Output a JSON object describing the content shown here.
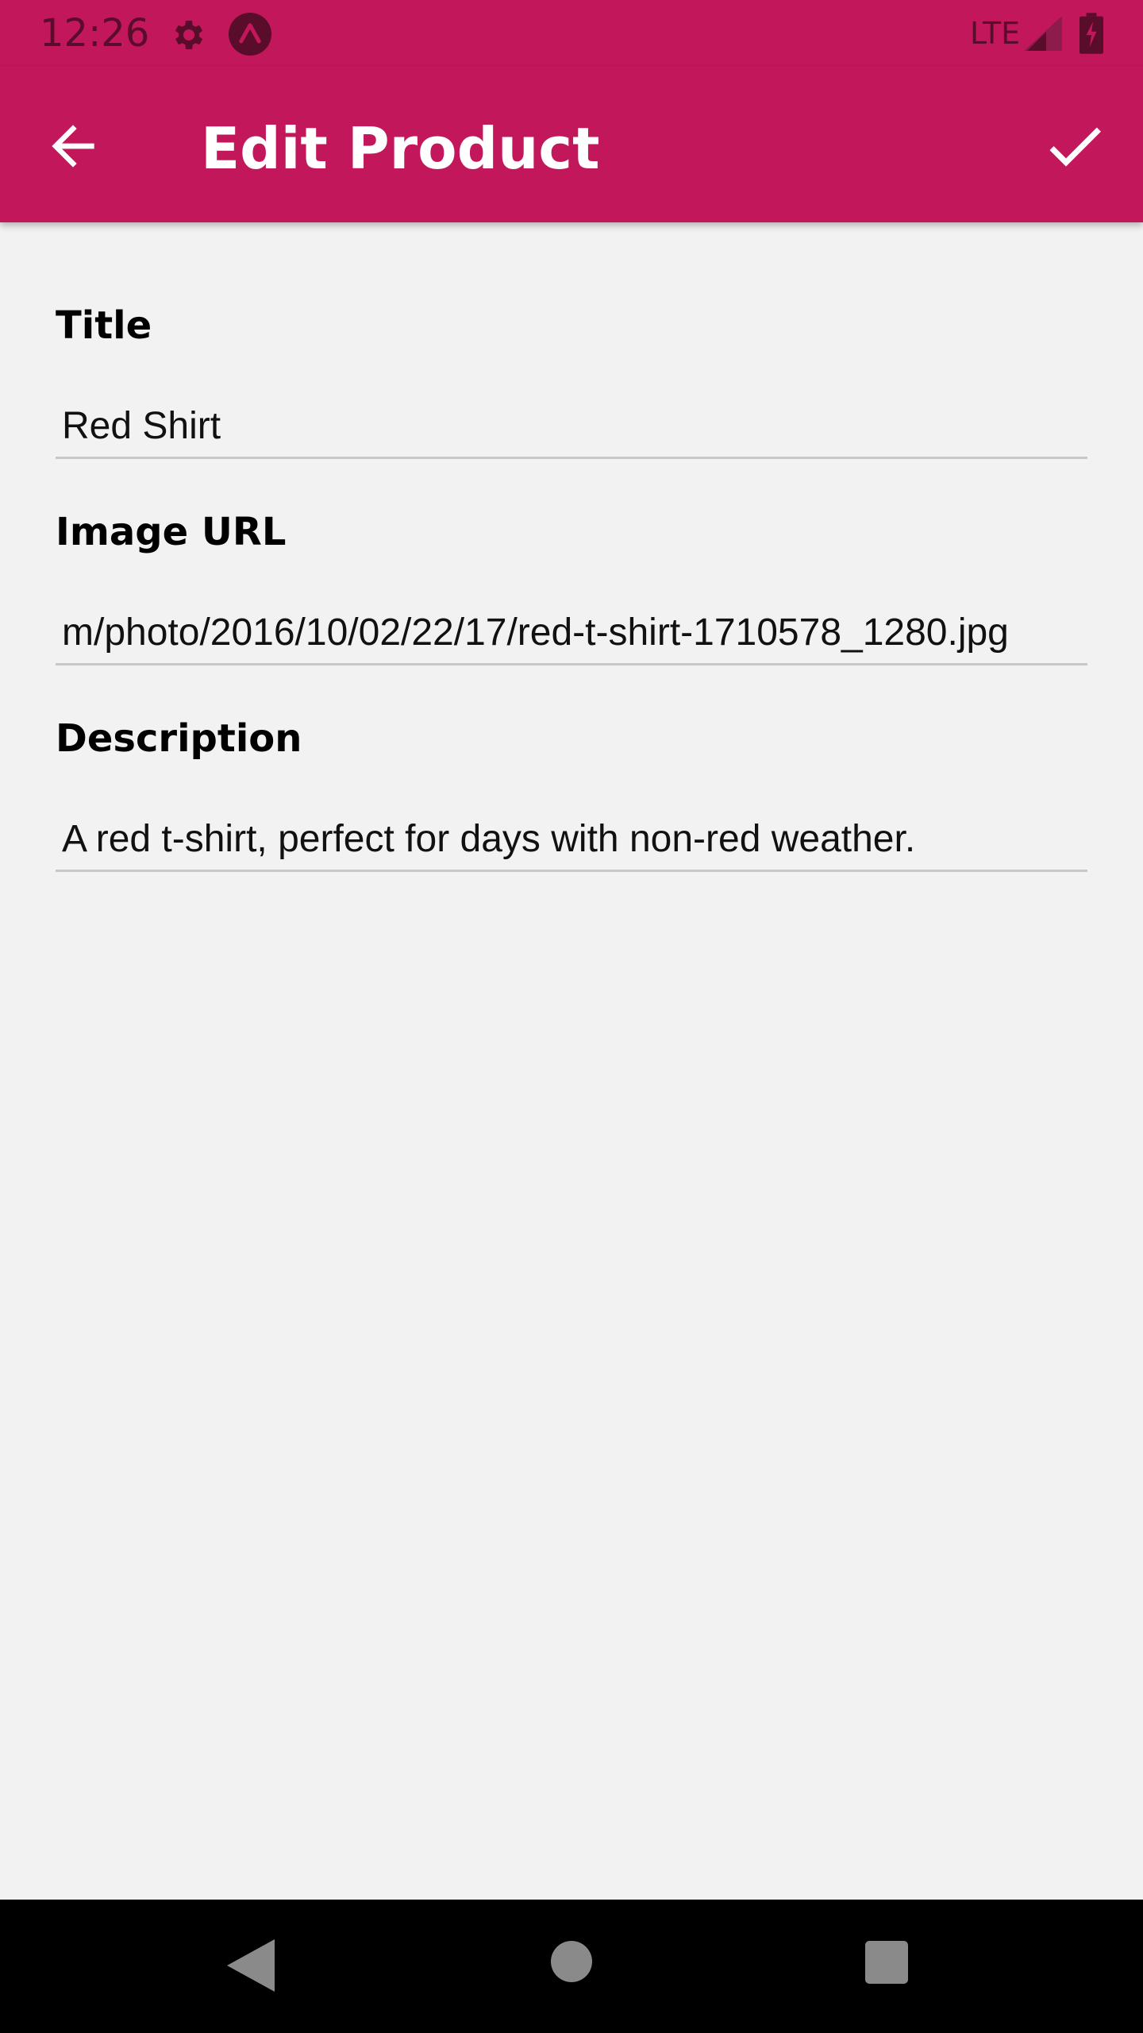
{
  "status_bar": {
    "time": "12:26",
    "network": "LTE",
    "icons": [
      "settings-gear-icon",
      "expo-icon",
      "signal-icon",
      "battery-charging-icon"
    ]
  },
  "app_bar": {
    "title": "Edit Product",
    "back_icon": "arrow-left-icon",
    "save_icon": "check-icon",
    "color": "#c2185b"
  },
  "form": {
    "fields": [
      {
        "label": "Title",
        "value": "Red Shirt"
      },
      {
        "label": "Image URL",
        "value": "m/photo/2016/10/02/22/17/red-t-shirt-1710578_1280.jpg"
      },
      {
        "label": "Description",
        "value": "A red t-shirt, perfect for days with non-red weather."
      }
    ]
  },
  "nav_bar": {
    "icons": [
      "nav-back-icon",
      "nav-home-icon",
      "nav-recent-apps-icon"
    ]
  }
}
